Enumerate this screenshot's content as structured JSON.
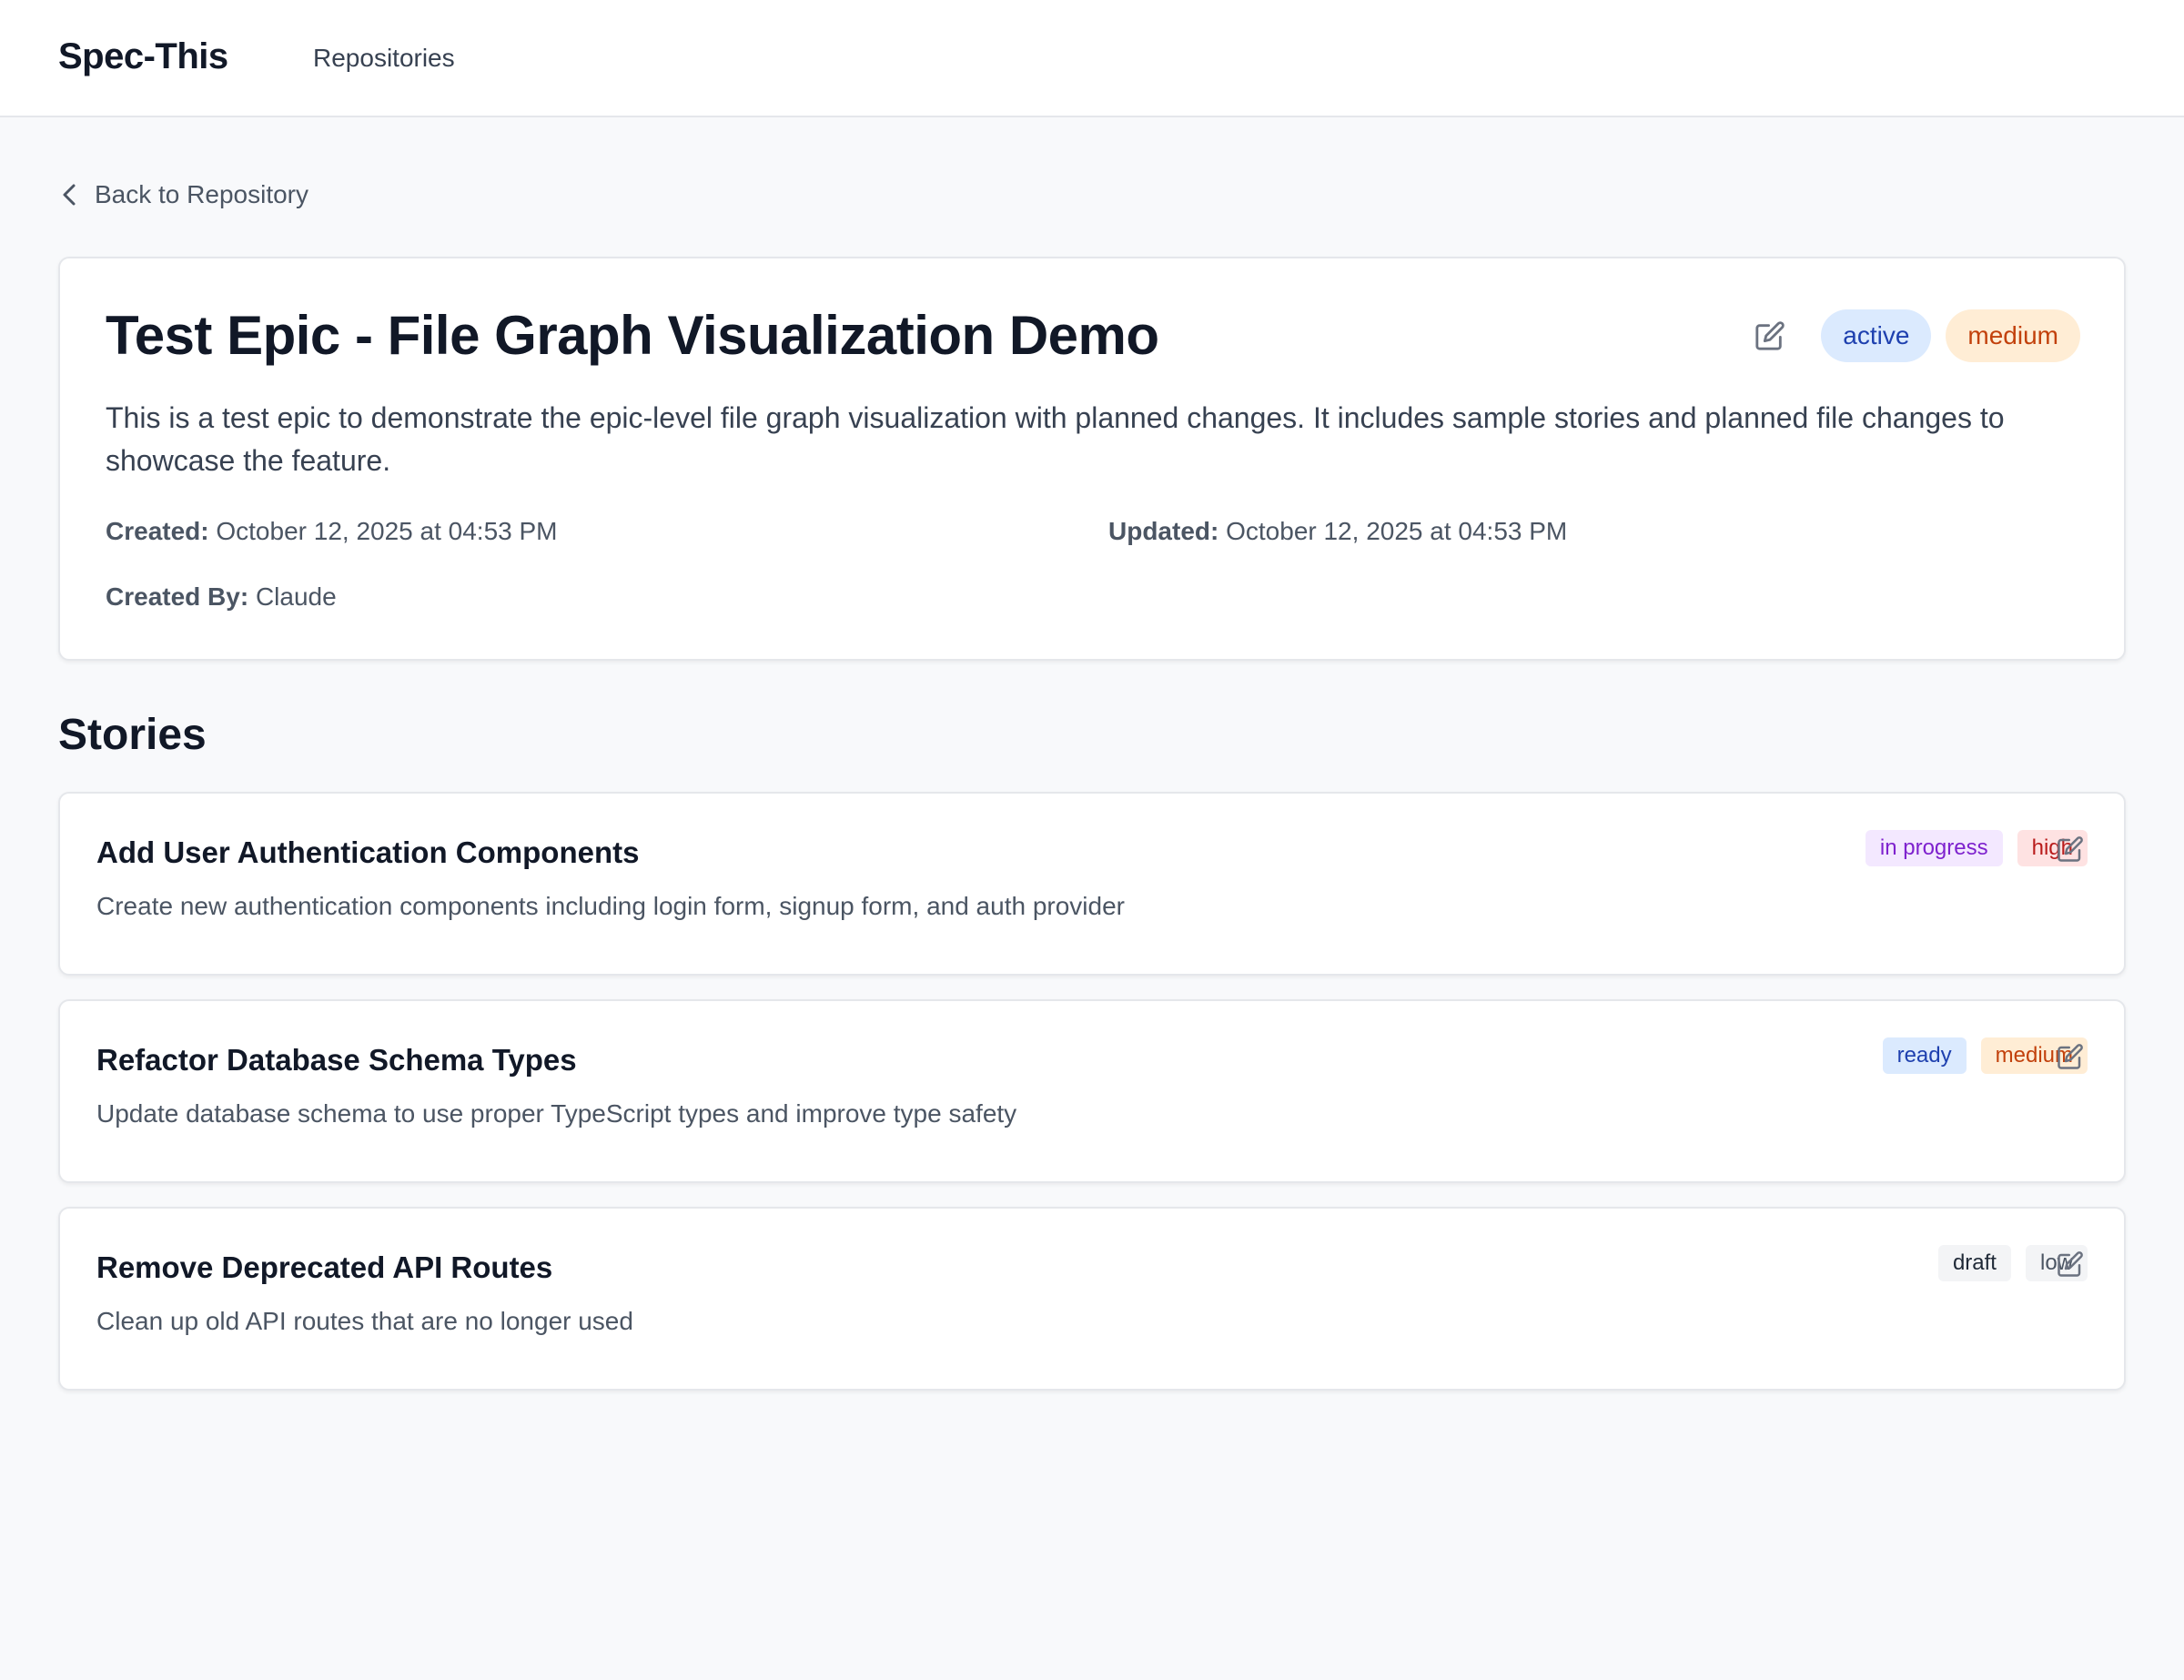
{
  "app": {
    "brand": "Spec-This",
    "nav": {
      "repositories": "Repositories"
    }
  },
  "back_link": "Back to Repository",
  "epic": {
    "title": "Test Epic - File Graph Visualization Demo",
    "status": "active",
    "priority": "medium",
    "description": "This is a test epic to demonstrate the epic-level file graph visualization with planned changes. It includes sample stories and planned file changes to showcase the feature.",
    "created_label": "Created:",
    "created_value": "October 12, 2025 at 04:53 PM",
    "updated_label": "Updated:",
    "updated_value": "October 12, 2025 at 04:53 PM",
    "created_by_label": "Created By:",
    "created_by_value": "Claude"
  },
  "stories_heading": "Stories",
  "stories": [
    {
      "title": "Add User Authentication Components",
      "description": "Create new authentication components including login form, signup form, and auth provider",
      "status": "in progress",
      "priority": "high"
    },
    {
      "title": "Refactor Database Schema Types",
      "description": "Update database schema to use proper TypeScript types and improve type safety",
      "status": "ready",
      "priority": "medium"
    },
    {
      "title": "Remove Deprecated API Routes",
      "description": "Clean up old API routes that are no longer used",
      "status": "draft",
      "priority": "low"
    }
  ],
  "colors": {
    "active_bg": "#dbeafe",
    "active_fg": "#1e40af",
    "medium_bg": "#ffedd5",
    "medium_fg": "#c2410c",
    "in_progress_bg": "#f3e8ff",
    "in_progress_fg": "#7e22ce",
    "high_bg": "#fee2e2",
    "high_fg": "#b91c1c",
    "ready_bg": "#dbeafe",
    "ready_fg": "#1e40af",
    "draft_bg": "#f3f4f6",
    "draft_fg": "#1f2937",
    "low_bg": "#f3f4f6",
    "low_fg": "#4b5563"
  },
  "icons": {
    "back": "chevron-left-icon",
    "edit": "edit-icon"
  }
}
